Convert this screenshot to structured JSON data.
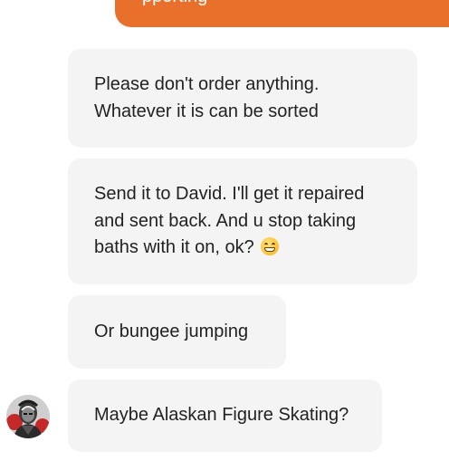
{
  "previous_sent_message": {
    "text": "pporting"
  },
  "messages": [
    {
      "text": "Please don't order anything.\nWhatever it is can be sorted"
    },
    {
      "text": "Send it to David. I'll get it repaired\nand sent back. And u stop taking\nbaths with it on, ok?",
      "emoji": "grinning-face-icon"
    },
    {
      "text": "Or bungee jumping"
    },
    {
      "text": "Maybe Alaskan Figure Skating?"
    }
  ],
  "colors": {
    "sent_bubble": "#e8702a",
    "received_bubble": "#f4f4f4",
    "text": "#222222"
  },
  "sender_avatar": {
    "icon": "avatar"
  }
}
